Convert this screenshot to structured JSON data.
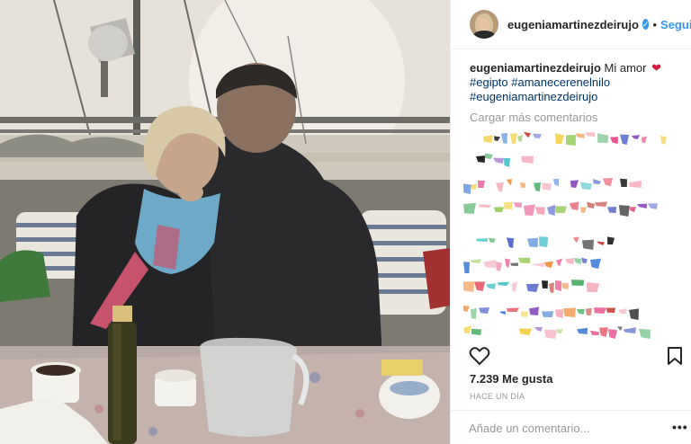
{
  "header": {
    "username": "eugeniamartinezdeirujo",
    "verified_glyph": "✓",
    "separator": "•",
    "follow_label": "Seguir"
  },
  "caption": {
    "username": "eugeniamartinezdeirujo",
    "text": "Mi amor",
    "emoji": "❤",
    "hashtags": [
      "#egipto #amanecerenelnilo",
      "#eugeniamartinezdeirujo"
    ]
  },
  "comments": {
    "load_more_label": "Cargar más comentarios"
  },
  "post": {
    "likes_label": "7.239 Me gusta",
    "timestamp": "HACE UN DÍA"
  },
  "comment_bar": {
    "placeholder": "Añade un comentario...",
    "more_glyph": "•••"
  },
  "icons": {
    "avatar": "profile-photo",
    "verified": "verified-badge-icon",
    "heart": "heart-emoji-icon",
    "like": "like-heart-icon",
    "save": "bookmark-icon",
    "more": "more-options-icon"
  },
  "colors": {
    "link_blue": "#3897f0",
    "hashtag": "#003569",
    "muted": "#999999",
    "text": "#262626"
  }
}
